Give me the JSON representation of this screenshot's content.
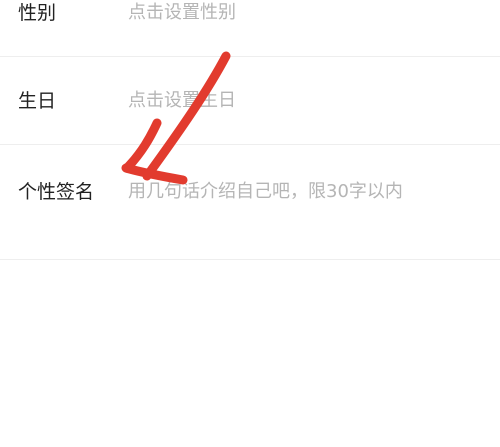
{
  "profile_form": {
    "rows": [
      {
        "label": "性别",
        "value": "点击设置性别"
      },
      {
        "label": "生日",
        "value": "点击设置生日"
      },
      {
        "label": "个性签名",
        "value": "用几句话介绍自己吧，限30字以内"
      }
    ]
  },
  "annotation": {
    "icon": "red-hand-drawn-arrow-icon",
    "color": "#e23b2e"
  }
}
